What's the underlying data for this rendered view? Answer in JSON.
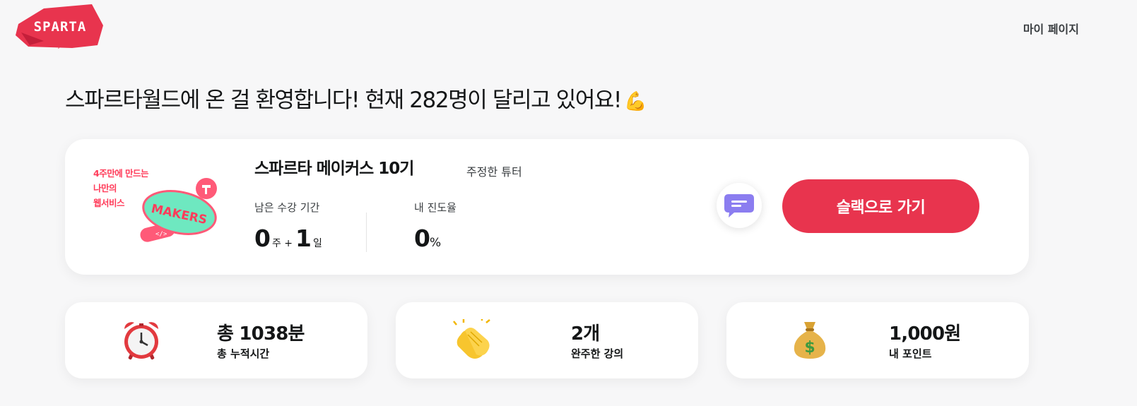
{
  "header": {
    "logo_text": "SPARTA",
    "logo_sub": "</>",
    "my_page": "마이 페이지"
  },
  "welcome": {
    "text": "스파르타월드에 온 걸 환영합니다! 현재 282명이 달리고 있어요!",
    "emoji": "💪"
  },
  "course": {
    "thumbnail_lines": [
      "4주만에 만드는",
      "나만의",
      "웹서비스"
    ],
    "thumbnail_badge": "MAKERS",
    "title": "스파르타 메이커스 10기",
    "tutor": "주정한 튜터",
    "period_label": "남은 수강 기간",
    "period_weeks": "0",
    "period_weeks_unit": "주 +",
    "period_days": "1",
    "period_days_unit": "일",
    "progress_label": "내 진도율",
    "progress_value": "0",
    "progress_unit": "%",
    "slack_button": "슬랙으로 가기"
  },
  "stats": [
    {
      "icon": "alarm-clock-icon",
      "value": "총 1038분",
      "label": "총 누적시간"
    },
    {
      "icon": "clapping-hands-icon",
      "value": "2개",
      "label": "완주한 강의"
    },
    {
      "icon": "money-bag-icon",
      "value": "1,000원",
      "label": "내 포인트"
    }
  ],
  "colors": {
    "brand": "#e8344e",
    "makers_mint": "#6ee8c0",
    "chat_purple": "#8b7df0",
    "background": "#f7f7f8"
  }
}
